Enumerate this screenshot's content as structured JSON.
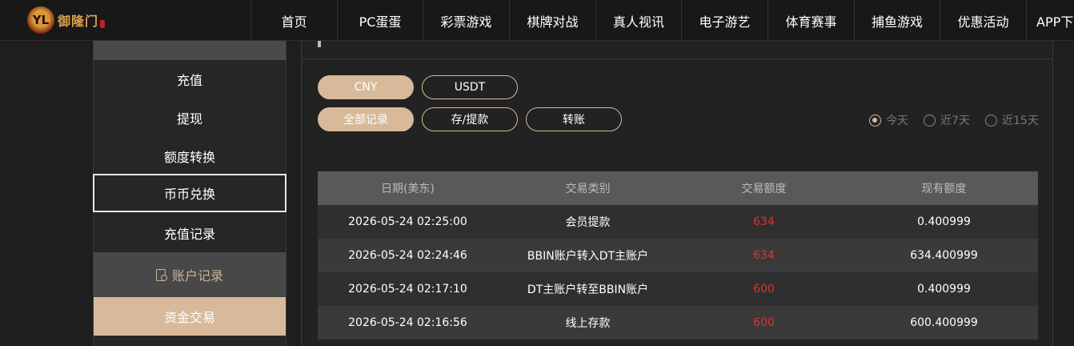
{
  "logo": {
    "mark": "YL",
    "text": "御隆门"
  },
  "nav": [
    {
      "label": "首页",
      "w": 0
    },
    {
      "label": "PC蛋蛋"
    },
    {
      "label": "彩票游戏"
    },
    {
      "label": "棋牌对战"
    },
    {
      "label": "真人视讯"
    },
    {
      "label": "电子游艺"
    },
    {
      "label": "体育赛事"
    },
    {
      "label": "捕鱼游戏"
    },
    {
      "label": "优惠活动"
    },
    {
      "label": "APP下载"
    }
  ],
  "sidebar": {
    "items": [
      "充值",
      "提现",
      "额度转换",
      "币币兑换",
      "充值记录"
    ],
    "group_label": "账户记录",
    "active_label": "资金交易"
  },
  "currency_tabs": [
    "CNY",
    "USDT"
  ],
  "record_tabs": [
    "全部记录",
    "存/提款",
    "转账"
  ],
  "date_filters": [
    "今天",
    "近7天",
    "近15天"
  ],
  "table": {
    "headers": [
      "日期(美东)",
      "交易类别",
      "交易额度",
      "现有额度"
    ],
    "rows": [
      {
        "date": "2026-05-24 02:25:00",
        "type": "会员提款",
        "amount": "634",
        "balance": "0.400999"
      },
      {
        "date": "2026-05-24 02:24:46",
        "type": "BBIN账户转入DT主账户",
        "amount": "634",
        "balance": "634.400999"
      },
      {
        "date": "2026-05-24 02:17:10",
        "type": "DT主账户转至BBIN账户",
        "amount": "600",
        "balance": "0.400999"
      },
      {
        "date": "2026-05-24 02:16:56",
        "type": "线上存款",
        "amount": "600",
        "balance": "600.400999"
      }
    ]
  },
  "colors": {
    "accent": "#d8b999",
    "amount": "#e03232"
  }
}
